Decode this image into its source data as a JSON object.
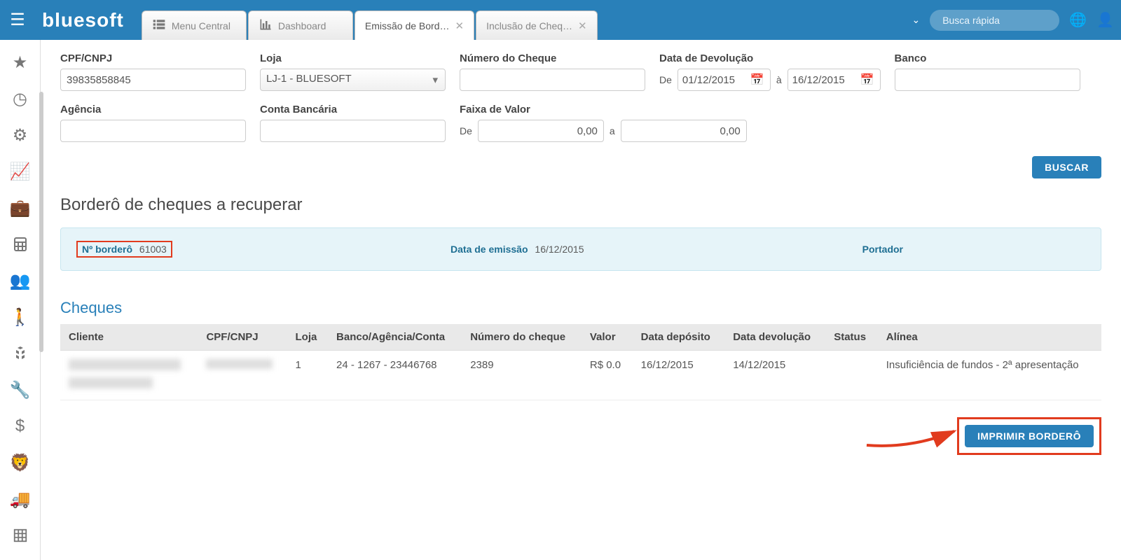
{
  "header": {
    "logo": "bluesoft",
    "tabs": [
      {
        "label": "Menu Central"
      },
      {
        "label": "Dashboard"
      },
      {
        "label": "Emissão de Bord…"
      },
      {
        "label": "Inclusão de Cheq…"
      }
    ],
    "search_placeholder": "Busca rápida"
  },
  "filters": {
    "cpf_label": "CPF/CNPJ",
    "cpf_value": "39835858845",
    "loja_label": "Loja",
    "loja_value": "LJ-1 - BLUESOFT",
    "numero_label": "Número do Cheque",
    "data_dev_label": "Data de Devolução",
    "de": "De",
    "a": "à",
    "date_from": "01/12/2015",
    "date_to": "16/12/2015",
    "banco_label": "Banco",
    "agencia_label": "Agência",
    "conta_label": "Conta Bancária",
    "faixa_label": "Faixa de Valor",
    "a2": "a",
    "val_default": "0,00",
    "buscar": "BUSCAR"
  },
  "section_title": "Borderô de cheques a recuperar",
  "infobar": {
    "bordero_label": "Nº borderô",
    "bordero_value": "61003",
    "emissao_label": "Data de emissão",
    "emissao_value": "16/12/2015",
    "portador_label": "Portador"
  },
  "cheques_title": "Cheques",
  "table": {
    "headers": [
      "Cliente",
      "CPF/CNPJ",
      "Loja",
      "Banco/Agência/Conta",
      "Número do cheque",
      "Valor",
      "Data depósito",
      "Data devolução",
      "Status",
      "Alínea"
    ],
    "row": {
      "loja": "1",
      "banco": "24 - 1267 - 23446768",
      "numero": "2389",
      "valor": "R$ 0.0",
      "deposito": "16/12/2015",
      "devolucao": "14/12/2015",
      "status": "",
      "alinea": "Insuficiência de fundos - 2ª apresentação"
    }
  },
  "imprimir": "IMPRIMIR BORDERÔ"
}
